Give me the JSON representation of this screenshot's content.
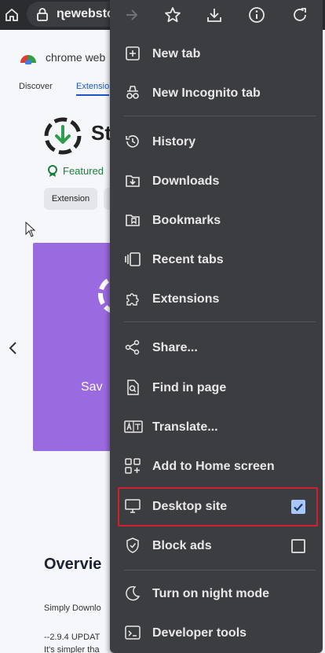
{
  "browser": {
    "url_fragment": "ɳewebsto",
    "icons": [
      "home-icon",
      "lock-icon"
    ]
  },
  "page": {
    "store_title": "chrome web",
    "tabs": {
      "discover": "Discover",
      "extensions": "Extensio"
    },
    "ext_title_fragment": "St",
    "featured": "Featured",
    "chip": "Extension",
    "banner_text": "Sav",
    "overview": "Overvie",
    "line1": "Simply Downlo",
    "line2": "--2.9.4 UPDAT",
    "line3": "It's simpler tha"
  },
  "menu": {
    "top_icons": [
      "forward-icon",
      "star-icon",
      "download-icon",
      "info-icon",
      "refresh-icon"
    ],
    "items": [
      {
        "label": "New tab",
        "icon": "new-tab-icon"
      },
      {
        "label": "New Incognito tab",
        "icon": "incognito-icon"
      },
      {
        "label": "History",
        "icon": "history-icon"
      },
      {
        "label": "Downloads",
        "icon": "downloads-icon"
      },
      {
        "label": "Bookmarks",
        "icon": "bookmarks-icon"
      },
      {
        "label": "Recent tabs",
        "icon": "recent-tabs-icon"
      },
      {
        "label": "Extensions",
        "icon": "extensions-icon"
      },
      {
        "label": "Share...",
        "icon": "share-icon"
      },
      {
        "label": "Find in page",
        "icon": "find-icon"
      },
      {
        "label": "Translate...",
        "icon": "translate-icon"
      },
      {
        "label": "Add to Home screen",
        "icon": "add-home-icon"
      },
      {
        "label": "Desktop site",
        "icon": "desktop-icon",
        "checked": true
      },
      {
        "label": "Block ads",
        "icon": "shield-icon",
        "checked": false
      },
      {
        "label": "Turn on night mode",
        "icon": "moon-icon"
      },
      {
        "label": "Developer tools",
        "icon": "terminal-icon"
      }
    ]
  },
  "colors": {
    "menu_bg": "#3c3d41",
    "highlight": "#d3202f",
    "checkbox_on": "#a8c7fa"
  }
}
